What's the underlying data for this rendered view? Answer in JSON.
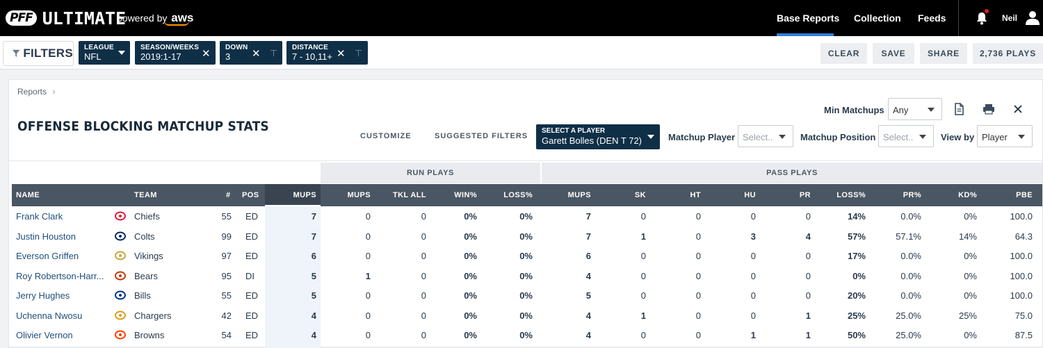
{
  "nav": {
    "logo_badge": "PFF",
    "logo_text": "ULTIMATE",
    "powered_by": "powered by",
    "powered_brand": "aws",
    "items": [
      {
        "label": "Base Reports",
        "active": true
      },
      {
        "label": "Collection",
        "active": false
      },
      {
        "label": "Feeds",
        "active": false
      }
    ],
    "user_name": "Neil"
  },
  "filterbar": {
    "filters_label": "FILTERS",
    "chips": [
      {
        "label": "LEAGUE",
        "value": "NFL"
      },
      {
        "label": "SEASON/WEEKS",
        "value": "2019:1-17"
      },
      {
        "label": "DOWN",
        "value": "3"
      },
      {
        "label": "DISTANCE",
        "value": "7 - 10,11+"
      }
    ],
    "actions": {
      "clear": "CLEAR",
      "save": "SAVE",
      "share": "SHARE",
      "plays": "2,736 PLAYS"
    }
  },
  "report": {
    "breadcrumb": "Reports",
    "breadcrumb_sep": "›",
    "title": "OFFENSE BLOCKING MATCHUP STATS",
    "min_matchups_label": "Min Matchups",
    "min_matchups_value": "Any",
    "customize": "CUSTOMIZE",
    "suggested_filters": "SUGGESTED FILTERS",
    "player_select_label": "SELECT A PLAYER",
    "player_select_value": "Garett Bolles (DEN T 72)",
    "matchup_player_label": "Matchup Player",
    "matchup_player_placeholder": "Select..",
    "matchup_position_label": "Matchup Position",
    "matchup_position_placeholder": "Select..",
    "view_by_label": "View by",
    "view_by_value": "Player"
  },
  "table": {
    "groups": {
      "run": "RUN PLAYS",
      "pass": "PASS PLAYS"
    },
    "headers": {
      "name": "NAME",
      "team": "TEAM",
      "num": "#",
      "pos": "POS",
      "mups": "MUPS",
      "run_mups": "MUPS",
      "tkl_all": "TKL ALL",
      "win": "WIN%",
      "run_loss": "LOSS%",
      "pass_mups": "MUPS",
      "sk": "SK",
      "ht": "HT",
      "hu": "HU",
      "pr": "PR",
      "pass_loss": "LOSS%",
      "pr_pct": "PR%",
      "kd": "KD%",
      "pbe": "PBE"
    },
    "rows": [
      {
        "name": "Frank Clark",
        "team": "Chiefs",
        "logo": "chiefs-logo-icon",
        "color": "#e31837",
        "num": "55",
        "pos": "ED",
        "mups": "7",
        "run_mups": "0",
        "tkl_all": "0",
        "win": "0%",
        "run_loss": "0%",
        "pass_mups": "7",
        "sk": "0",
        "ht": "0",
        "hu": "0",
        "pr": "0",
        "pass_loss": "14%",
        "pr_pct": "0.0%",
        "kd": "0%",
        "pbe": "100.0"
      },
      {
        "name": "Justin Houston",
        "team": "Colts",
        "logo": "colts-logo-icon",
        "color": "#002c5f",
        "num": "99",
        "pos": "ED",
        "mups": "7",
        "run_mups": "0",
        "tkl_all": "0",
        "win": "0%",
        "run_loss": "0%",
        "pass_mups": "7",
        "sk": "1",
        "ht": "0",
        "hu": "3",
        "pr": "4",
        "pass_loss": "57%",
        "pr_pct": "57.1%",
        "kd": "14%",
        "pbe": "64.3"
      },
      {
        "name": "Everson Griffen",
        "team": "Vikings",
        "logo": "vikings-logo-icon",
        "color": "#c9a43a",
        "num": "97",
        "pos": "ED",
        "mups": "6",
        "run_mups": "0",
        "tkl_all": "0",
        "win": "0%",
        "run_loss": "0%",
        "pass_mups": "6",
        "sk": "0",
        "ht": "0",
        "hu": "0",
        "pr": "0",
        "pass_loss": "17%",
        "pr_pct": "0.0%",
        "kd": "0%",
        "pbe": "100.0"
      },
      {
        "name": "Roy Robertson-Harr...",
        "team": "Bears",
        "logo": "bears-logo-icon",
        "color": "#c83803",
        "num": "95",
        "pos": "DI",
        "mups": "5",
        "run_mups": "1",
        "tkl_all": "0",
        "win": "0%",
        "run_loss": "0%",
        "pass_mups": "4",
        "sk": "0",
        "ht": "0",
        "hu": "0",
        "pr": "0",
        "pass_loss": "0%",
        "pr_pct": "0.0%",
        "kd": "0%",
        "pbe": "100.0"
      },
      {
        "name": "Jerry Hughes",
        "team": "Bills",
        "logo": "bills-logo-icon",
        "color": "#00338d",
        "num": "55",
        "pos": "ED",
        "mups": "5",
        "run_mups": "0",
        "tkl_all": "0",
        "win": "0%",
        "run_loss": "0%",
        "pass_mups": "5",
        "sk": "0",
        "ht": "0",
        "hu": "0",
        "pr": "0",
        "pass_loss": "20%",
        "pr_pct": "0.0%",
        "kd": "0%",
        "pbe": "100.0"
      },
      {
        "name": "Uchenna Nwosu",
        "team": "Chargers",
        "logo": "chargers-logo-icon",
        "color": "#d4a017",
        "num": "42",
        "pos": "ED",
        "mups": "4",
        "run_mups": "0",
        "tkl_all": "0",
        "win": "0%",
        "run_loss": "0%",
        "pass_mups": "4",
        "sk": "1",
        "ht": "0",
        "hu": "0",
        "pr": "1",
        "pass_loss": "25%",
        "pr_pct": "25.0%",
        "kd": "25%",
        "pbe": "75.0"
      },
      {
        "name": "Olivier Vernon",
        "team": "Browns",
        "logo": "browns-logo-icon",
        "color": "#ff3c00",
        "num": "54",
        "pos": "ED",
        "mups": "4",
        "run_mups": "0",
        "tkl_all": "0",
        "win": "0%",
        "run_loss": "0%",
        "pass_mups": "4",
        "sk": "0",
        "ht": "0",
        "hu": "1",
        "pr": "1",
        "pass_loss": "50%",
        "pr_pct": "25.0%",
        "kd": "0%",
        "pbe": "87.5"
      }
    ]
  }
}
